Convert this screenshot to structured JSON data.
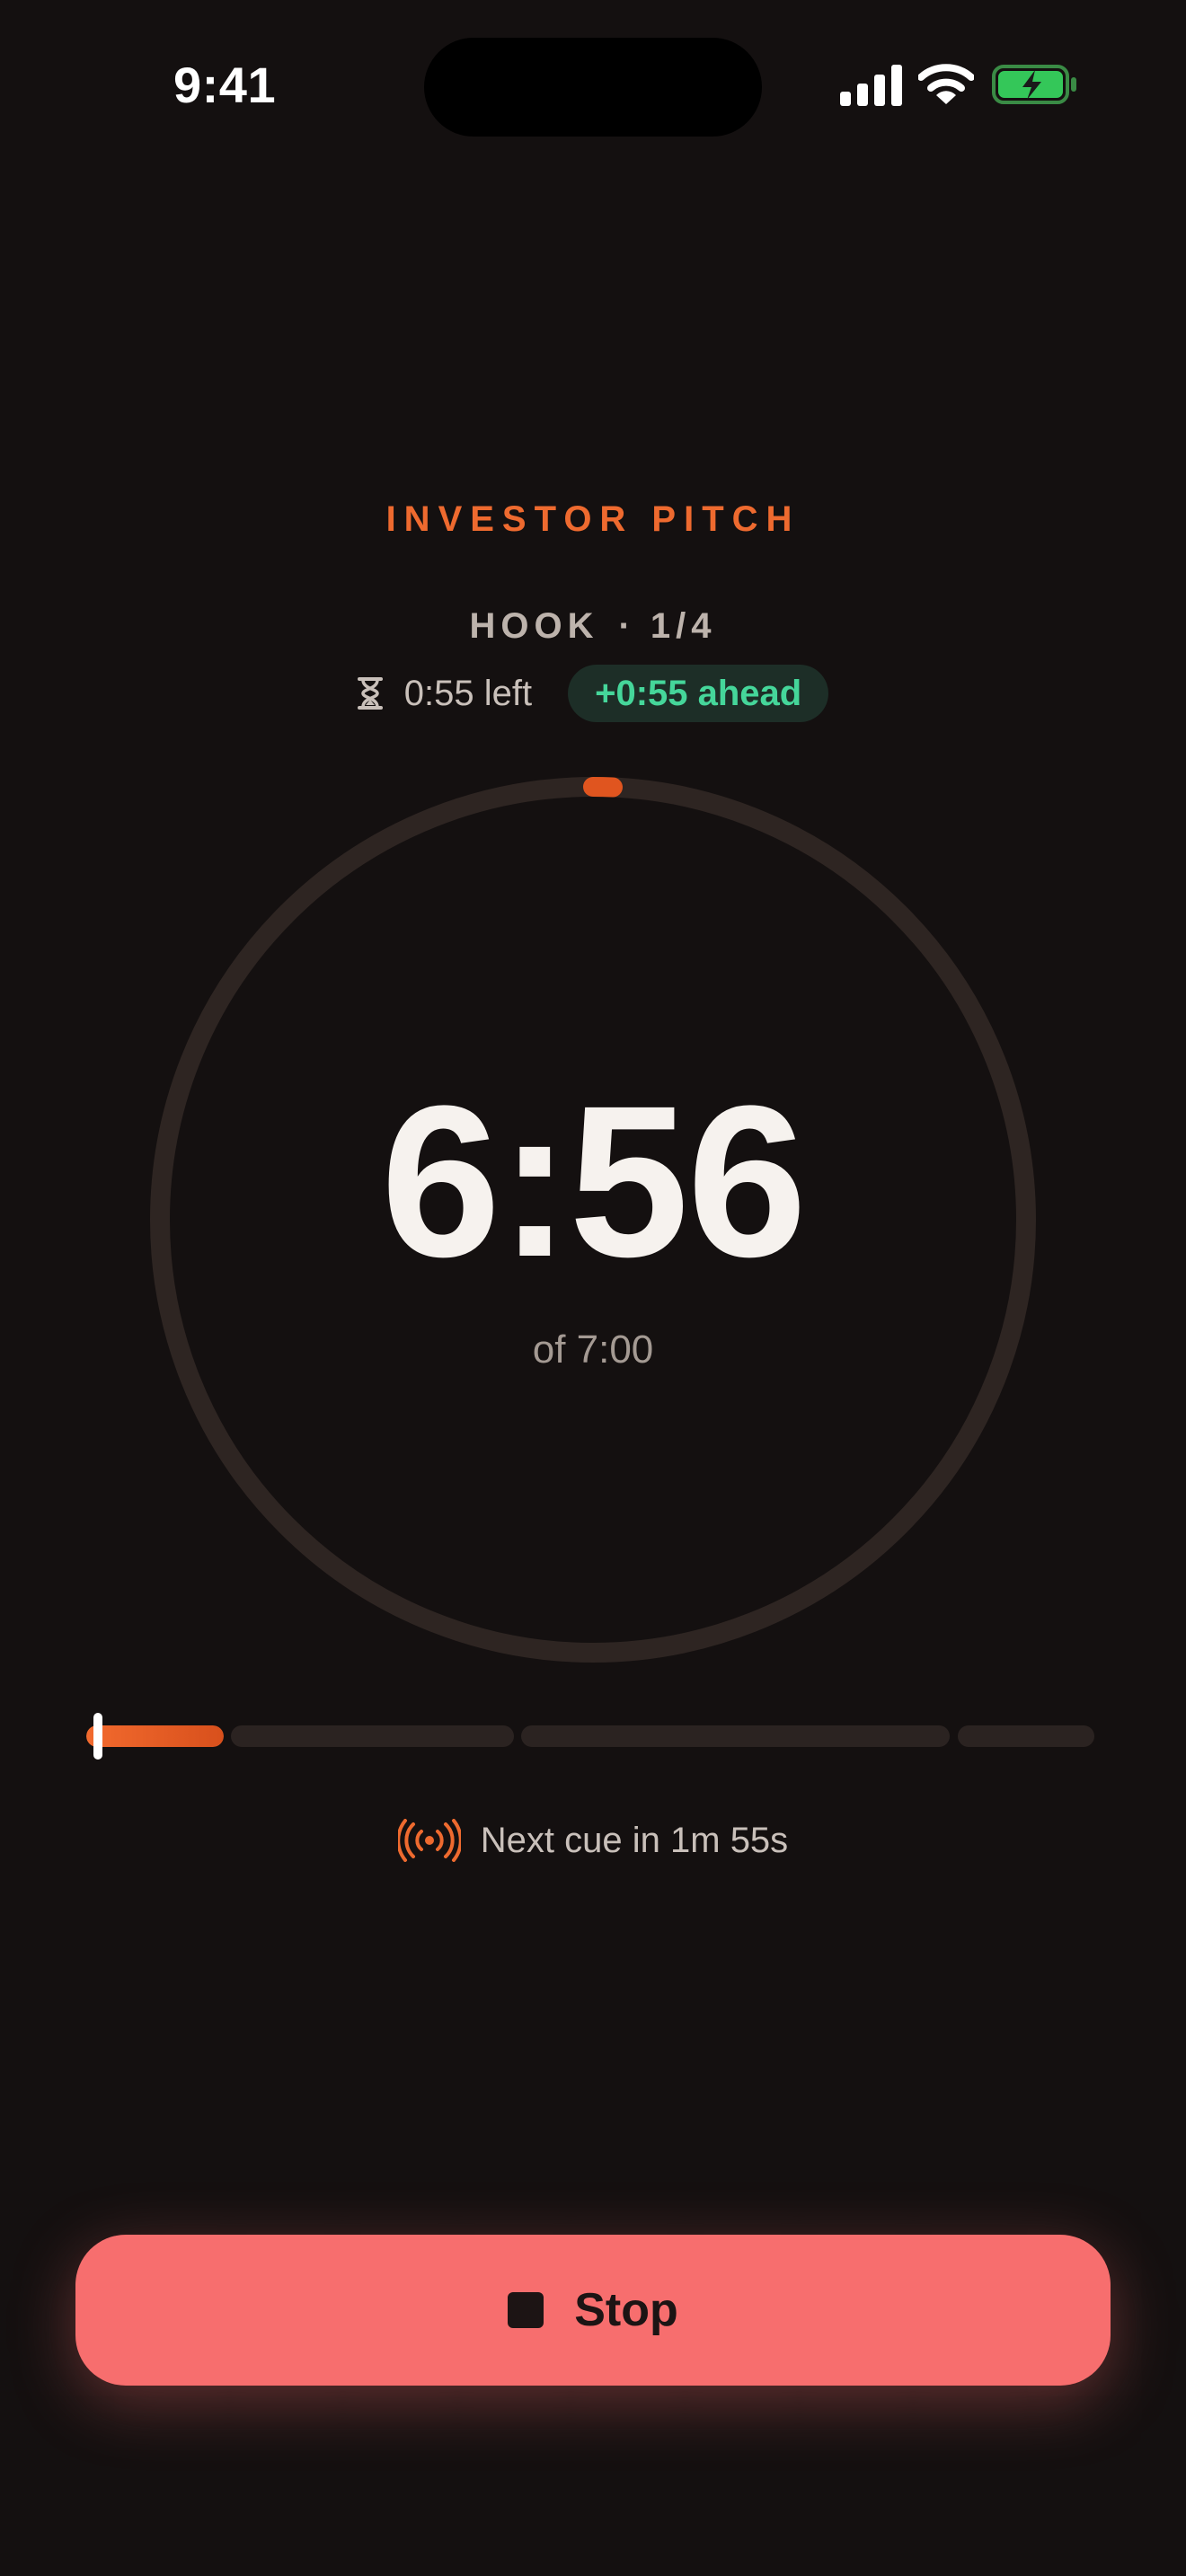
{
  "status_bar": {
    "time": "9:41"
  },
  "session": {
    "title": "INVESTOR PITCH"
  },
  "section": {
    "name": "HOOK",
    "separator": "·",
    "position": "1/4",
    "time_left": "0:55 left",
    "pace_badge": "+0:55 ahead"
  },
  "timer": {
    "elapsed": "6:56",
    "total": "of 7:00"
  },
  "progress": {
    "segments_relative_length": [
      0.15,
      0.31,
      0.47,
      0.15
    ],
    "current_segment_fill_fraction": 1.0
  },
  "cue": {
    "text": "Next cue in 1m 55s"
  },
  "stop_button": {
    "label": "Stop"
  },
  "colors": {
    "background": "#141010",
    "accent": "#ee6a2f",
    "ahead_green": "#45d69a",
    "stop": "#f76e6e"
  },
  "icons": [
    "signal-icon",
    "wifi-icon",
    "battery-charging-icon",
    "hourglass-icon",
    "broadcast-icon",
    "stop-square-icon"
  ]
}
